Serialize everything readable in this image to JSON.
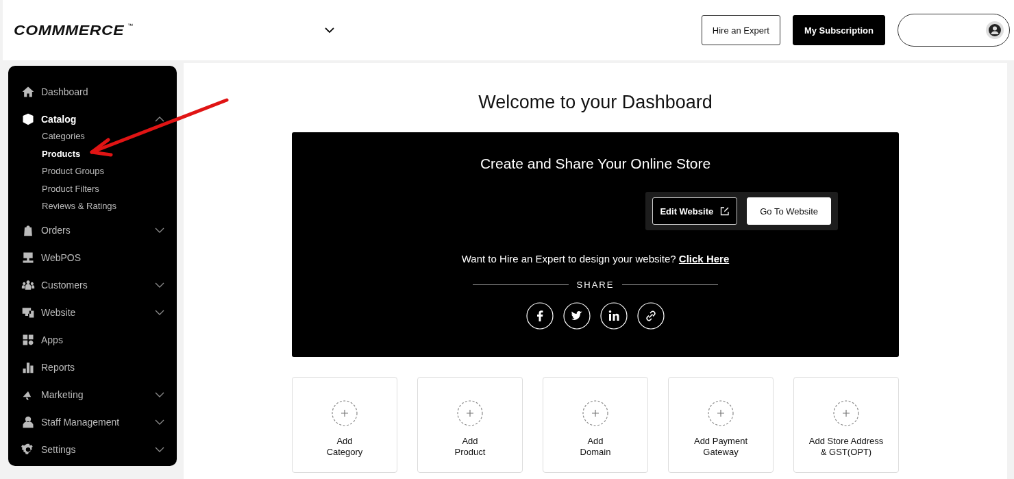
{
  "header": {
    "logo": "COMMMERCE",
    "logo_mark": "™",
    "buttons": [
      {
        "label": "Hire an Expert",
        "kind": "outline"
      },
      {
        "label": "My Subscription",
        "kind": "solid"
      }
    ]
  },
  "sidebar": {
    "items": [
      {
        "label": "Dashboard"
      },
      {
        "label": "Catalog",
        "expanded": true,
        "children": [
          {
            "label": "Categories",
            "selected": false
          },
          {
            "label": "Products",
            "selected": true
          },
          {
            "label": "Product Groups",
            "selected": false
          },
          {
            "label": "Product Filters",
            "selected": false
          },
          {
            "label": "Reviews & Ratings",
            "selected": false
          }
        ]
      },
      {
        "label": "Orders",
        "expanded": false
      },
      {
        "label": "WebPOS"
      },
      {
        "label": "Customers",
        "expanded": false
      },
      {
        "label": "Website",
        "expanded": false
      },
      {
        "label": "Apps"
      },
      {
        "label": "Reports"
      },
      {
        "label": "Marketing",
        "expanded": false
      },
      {
        "label": "Staff Management",
        "expanded": false
      },
      {
        "label": "Settings",
        "expanded": false
      }
    ]
  },
  "main": {
    "title": "Welcome to your Dashboard",
    "banner": {
      "title": "Create and Share Your Online Store",
      "buttons": [
        {
          "label": "Edit Website",
          "kind": "outline"
        },
        {
          "label": "Go To Website",
          "kind": "solid"
        }
      ],
      "hire_text": "Want to Hire an Expert to design your website?",
      "hire_link": "Click Here",
      "share_label": "SHARE"
    },
    "cards": [
      {
        "lines": [
          "Add",
          "Category"
        ]
      },
      {
        "lines": [
          "Add",
          "Product"
        ]
      },
      {
        "lines": [
          "Add",
          "Domain"
        ]
      },
      {
        "lines": [
          "Add Payment",
          "Gateway"
        ]
      },
      {
        "lines": [
          "Add Store Address",
          "& GST(OPT)"
        ]
      }
    ]
  }
}
